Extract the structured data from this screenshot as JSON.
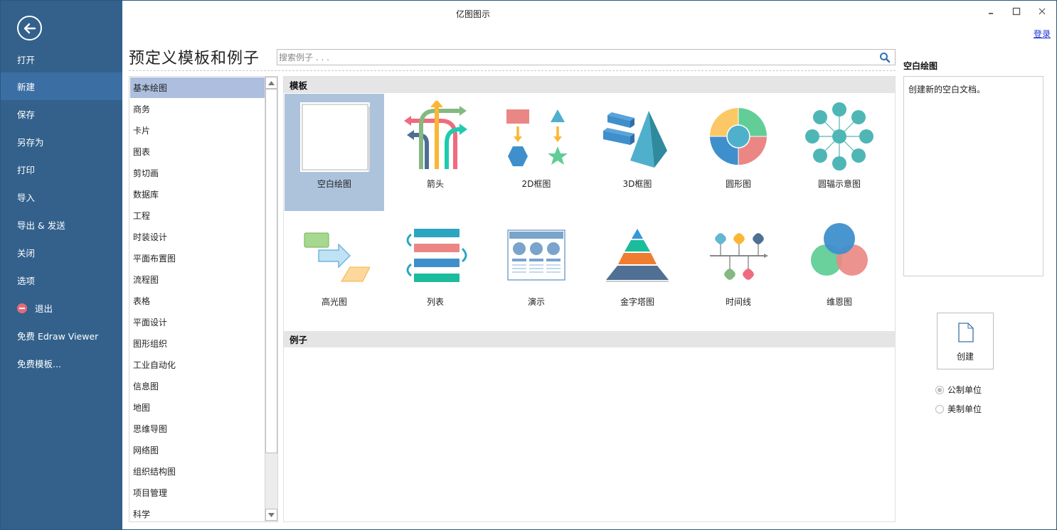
{
  "window": {
    "title": "亿图图示",
    "login_label": "登录",
    "controls": [
      "minimize-icon",
      "maximize-icon",
      "close-icon"
    ]
  },
  "sidebar": {
    "back_icon": "arrow-left-circle-icon",
    "items": [
      {
        "label": "打开",
        "active": false
      },
      {
        "label": "新建",
        "active": true
      },
      {
        "label": "保存",
        "active": false
      },
      {
        "label": "另存为",
        "active": false
      },
      {
        "label": "打印",
        "active": false
      },
      {
        "label": "导入",
        "active": false
      },
      {
        "label": "导出 & 发送",
        "active": false
      },
      {
        "label": "关闭",
        "active": false
      },
      {
        "label": "选项",
        "active": false
      },
      {
        "label": "退出",
        "active": false,
        "icon": "exit-icon"
      },
      {
        "label": "免费 Edraw Viewer",
        "active": false
      },
      {
        "label": "免费模板...",
        "active": false
      }
    ]
  },
  "header": {
    "title": "预定义模板和例子",
    "search_placeholder": "搜索例子 . . ."
  },
  "categories": [
    {
      "label": "基本绘图",
      "selected": true
    },
    {
      "label": "商务"
    },
    {
      "label": "卡片"
    },
    {
      "label": "图表"
    },
    {
      "label": "剪切画"
    },
    {
      "label": "数据库"
    },
    {
      "label": "工程"
    },
    {
      "label": "时装设计"
    },
    {
      "label": "平面布置图"
    },
    {
      "label": "流程图"
    },
    {
      "label": "表格"
    },
    {
      "label": "平面设计"
    },
    {
      "label": "图形组织"
    },
    {
      "label": "工业自动化"
    },
    {
      "label": "信息图"
    },
    {
      "label": "地图"
    },
    {
      "label": "思维导图"
    },
    {
      "label": "网络图"
    },
    {
      "label": "组织结构图"
    },
    {
      "label": "项目管理"
    },
    {
      "label": "科学"
    }
  ],
  "templates_section": {
    "header": "模板",
    "items": [
      {
        "label": "空白绘图",
        "icon": "blank-page-icon",
        "selected": true
      },
      {
        "label": "箭头",
        "icon": "arrows-icon"
      },
      {
        "label": "2D框图",
        "icon": "2d-block-icon"
      },
      {
        "label": "3D框图",
        "icon": "3d-block-icon"
      },
      {
        "label": "圆形图",
        "icon": "circular-chart-icon"
      },
      {
        "label": "圆辐示意图",
        "icon": "radial-diagram-icon"
      },
      {
        "label": "高光图",
        "icon": "highlight-diagram-icon"
      },
      {
        "label": "列表",
        "icon": "list-icon"
      },
      {
        "label": "演示",
        "icon": "presentation-icon"
      },
      {
        "label": "金字塔图",
        "icon": "pyramid-icon"
      },
      {
        "label": "时间线",
        "icon": "timeline-icon"
      },
      {
        "label": "维恩图",
        "icon": "venn-icon"
      }
    ]
  },
  "examples_section": {
    "header": "例子"
  },
  "right_panel": {
    "title": "空白绘图",
    "description": "创建新的空白文档。",
    "create_label": "创建",
    "units": [
      {
        "label": "公制单位",
        "checked": true
      },
      {
        "label": "美制单位",
        "checked": false
      }
    ]
  },
  "colors": {
    "sidebar_bg": "#33618c",
    "sidebar_active": "#3b6ea3",
    "category_selected": "#adbedf",
    "template_selected": "#adc3dc",
    "link": "#1a33d6"
  }
}
